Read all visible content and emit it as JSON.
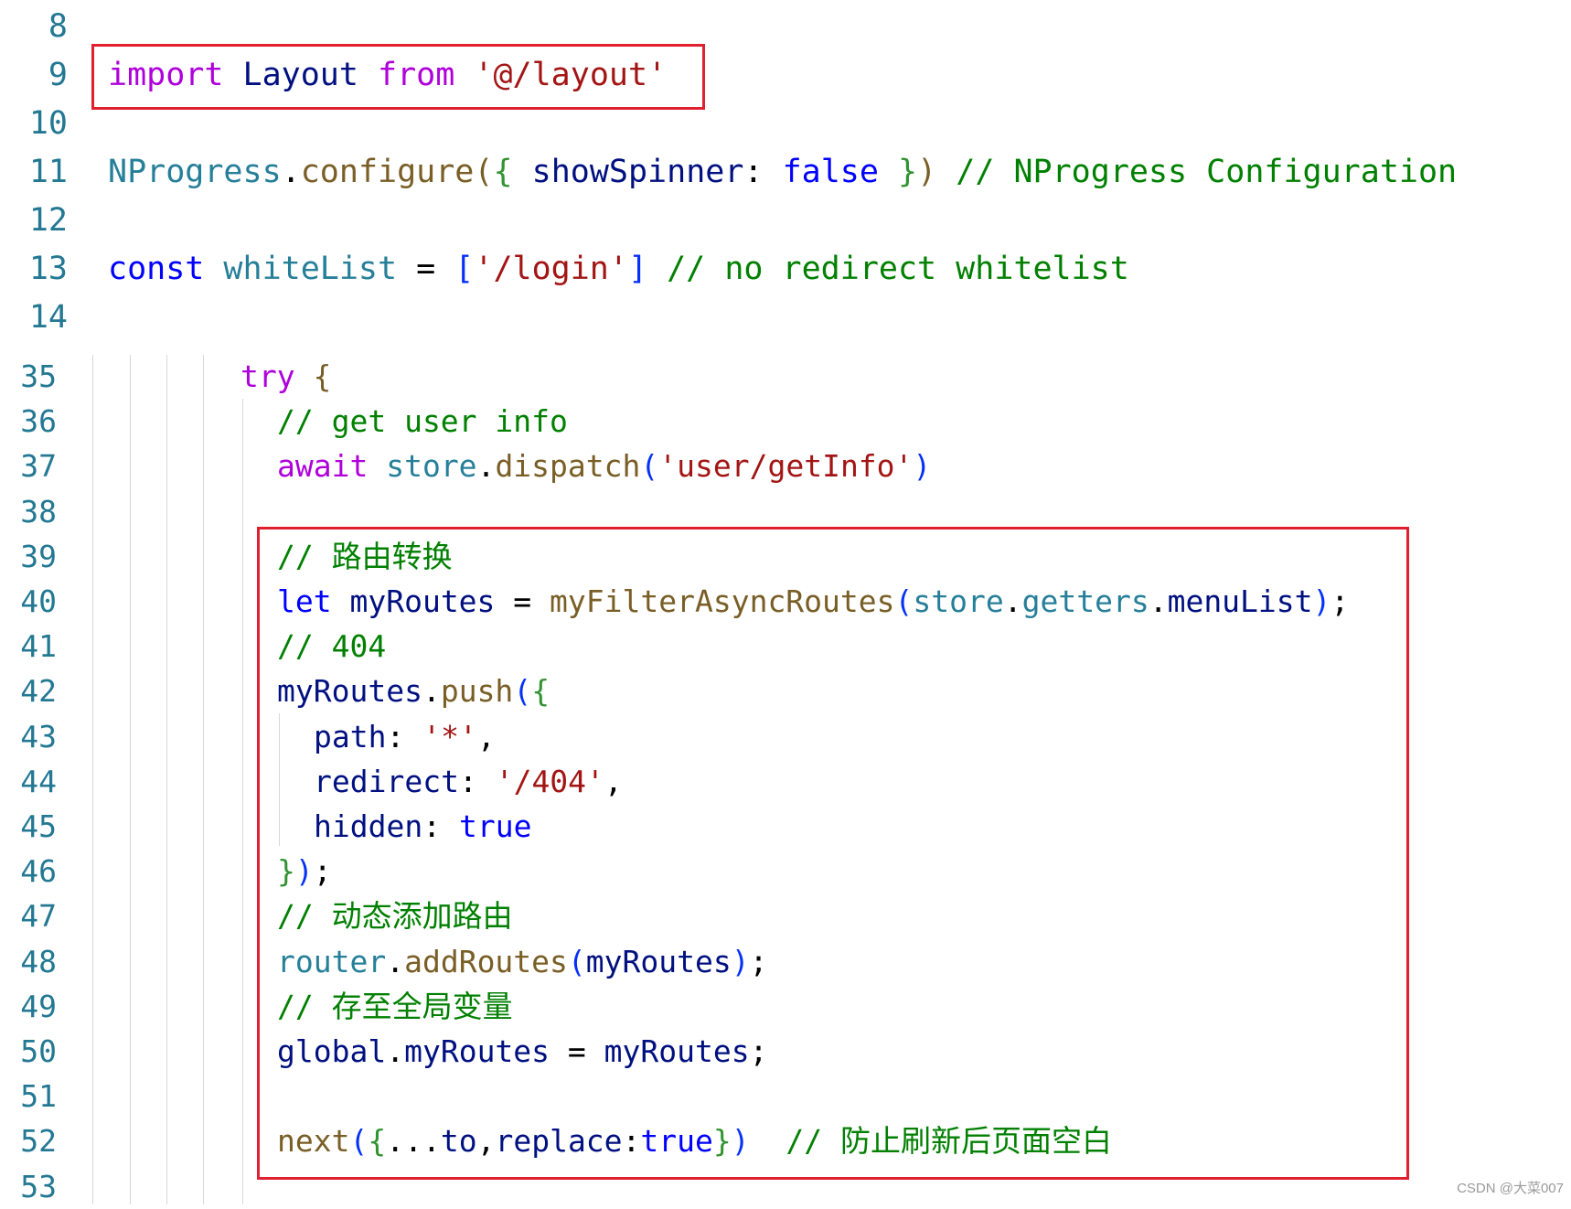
{
  "colors": {
    "keyword_control": "#af00db",
    "keyword_storage": "#0000ff",
    "identifier": "#001080",
    "function": "#795e26",
    "string": "#a31515",
    "comment": "#008000",
    "line_number": "#237893",
    "highlight_box": "#e0202e"
  },
  "top_block": [
    {
      "ln": "8",
      "tokens": []
    },
    {
      "ln": "9",
      "tokens": [
        {
          "t": "import",
          "c": "kw-purple"
        },
        {
          "t": " Layout ",
          "c": "ident"
        },
        {
          "t": "from",
          "c": "kw-purple"
        },
        {
          "t": " ",
          "c": "punc"
        },
        {
          "t": "'@/layout'",
          "c": "str"
        }
      ]
    },
    {
      "ln": "10",
      "tokens": []
    },
    {
      "ln": "11",
      "tokens": [
        {
          "t": "NProgress",
          "c": "typename"
        },
        {
          "t": ".",
          "c": "punc"
        },
        {
          "t": "configure",
          "c": "func"
        },
        {
          "t": "(",
          "c": "brace-y"
        },
        {
          "t": "{",
          "c": "brace-p"
        },
        {
          "t": " showSpinner",
          "c": "ident"
        },
        {
          "t": ": ",
          "c": "punc"
        },
        {
          "t": "false",
          "c": "bool"
        },
        {
          "t": " ",
          "c": "punc"
        },
        {
          "t": "}",
          "c": "brace-p"
        },
        {
          "t": ")",
          "c": "brace-y"
        },
        {
          "t": " // NProgress Configuration",
          "c": "cmt"
        }
      ]
    },
    {
      "ln": "12",
      "tokens": []
    },
    {
      "ln": "13",
      "tokens": [
        {
          "t": "const",
          "c": "kw-blue"
        },
        {
          "t": " whiteList",
          "c": "typename"
        },
        {
          "t": " = ",
          "c": "punc"
        },
        {
          "t": "[",
          "c": "brace-b"
        },
        {
          "t": "'/login'",
          "c": "str"
        },
        {
          "t": "]",
          "c": "brace-b"
        },
        {
          "t": " // no redirect whitelist",
          "c": "cmt"
        }
      ]
    },
    {
      "ln": "14",
      "tokens": []
    }
  ],
  "bottom_block": [
    {
      "ln": "35",
      "indent": 0,
      "tokens": [
        {
          "t": "try",
          "c": "kw-purple"
        },
        {
          "t": " ",
          "c": "punc"
        },
        {
          "t": "{",
          "c": "brace-y"
        }
      ]
    },
    {
      "ln": "36",
      "indent": 1,
      "tokens": [
        {
          "t": "// get user info",
          "c": "cmt"
        }
      ]
    },
    {
      "ln": "37",
      "indent": 1,
      "tokens": [
        {
          "t": "await",
          "c": "kw-purple"
        },
        {
          "t": " store",
          "c": "typename"
        },
        {
          "t": ".",
          "c": "punc"
        },
        {
          "t": "dispatch",
          "c": "func"
        },
        {
          "t": "(",
          "c": "brace-b"
        },
        {
          "t": "'user/getInfo'",
          "c": "str"
        },
        {
          "t": ")",
          "c": "brace-b"
        }
      ]
    },
    {
      "ln": "38",
      "indent": 1,
      "tokens": []
    },
    {
      "ln": "39",
      "indent": 1,
      "tokens": [
        {
          "t": "// 路由转换",
          "c": "cmt"
        }
      ]
    },
    {
      "ln": "40",
      "indent": 1,
      "tokens": [
        {
          "t": "let",
          "c": "kw-blue"
        },
        {
          "t": " myRoutes",
          "c": "ident"
        },
        {
          "t": " = ",
          "c": "punc"
        },
        {
          "t": "myFilterAsyncRoutes",
          "c": "func"
        },
        {
          "t": "(",
          "c": "brace-b"
        },
        {
          "t": "store",
          "c": "typename"
        },
        {
          "t": ".",
          "c": "punc"
        },
        {
          "t": "getters",
          "c": "typename"
        },
        {
          "t": ".",
          "c": "punc"
        },
        {
          "t": "menuList",
          "c": "ident"
        },
        {
          "t": ")",
          "c": "brace-b"
        },
        {
          "t": ";",
          "c": "punc"
        }
      ]
    },
    {
      "ln": "41",
      "indent": 1,
      "tokens": [
        {
          "t": "// 404",
          "c": "cmt"
        }
      ]
    },
    {
      "ln": "42",
      "indent": 1,
      "tokens": [
        {
          "t": "myRoutes",
          "c": "ident"
        },
        {
          "t": ".",
          "c": "punc"
        },
        {
          "t": "push",
          "c": "func"
        },
        {
          "t": "(",
          "c": "brace-b"
        },
        {
          "t": "{",
          "c": "brace-p"
        }
      ]
    },
    {
      "ln": "43",
      "indent": 2,
      "tokens": [
        {
          "t": "path",
          "c": "ident"
        },
        {
          "t": ": ",
          "c": "punc"
        },
        {
          "t": "'*'",
          "c": "str"
        },
        {
          "t": ",",
          "c": "punc"
        }
      ]
    },
    {
      "ln": "44",
      "indent": 2,
      "tokens": [
        {
          "t": "redirect",
          "c": "ident"
        },
        {
          "t": ": ",
          "c": "punc"
        },
        {
          "t": "'/404'",
          "c": "str"
        },
        {
          "t": ",",
          "c": "punc"
        }
      ]
    },
    {
      "ln": "45",
      "indent": 2,
      "tokens": [
        {
          "t": "hidden",
          "c": "ident"
        },
        {
          "t": ": ",
          "c": "punc"
        },
        {
          "t": "true",
          "c": "bool"
        }
      ]
    },
    {
      "ln": "46",
      "indent": 1,
      "tokens": [
        {
          "t": "}",
          "c": "brace-p"
        },
        {
          "t": ")",
          "c": "brace-b"
        },
        {
          "t": ";",
          "c": "punc"
        }
      ]
    },
    {
      "ln": "47",
      "indent": 1,
      "tokens": [
        {
          "t": "// 动态添加路由",
          "c": "cmt"
        }
      ]
    },
    {
      "ln": "48",
      "indent": 1,
      "tokens": [
        {
          "t": "router",
          "c": "typename"
        },
        {
          "t": ".",
          "c": "punc"
        },
        {
          "t": "addRoutes",
          "c": "func"
        },
        {
          "t": "(",
          "c": "brace-b"
        },
        {
          "t": "myRoutes",
          "c": "ident"
        },
        {
          "t": ")",
          "c": "brace-b"
        },
        {
          "t": ";",
          "c": "punc"
        }
      ]
    },
    {
      "ln": "49",
      "indent": 1,
      "tokens": [
        {
          "t": "// 存至全局变量",
          "c": "cmt"
        }
      ]
    },
    {
      "ln": "50",
      "indent": 1,
      "tokens": [
        {
          "t": "global",
          "c": "ident"
        },
        {
          "t": ".",
          "c": "punc"
        },
        {
          "t": "myRoutes",
          "c": "ident"
        },
        {
          "t": " = ",
          "c": "punc"
        },
        {
          "t": "myRoutes",
          "c": "ident"
        },
        {
          "t": ";",
          "c": "punc"
        }
      ]
    },
    {
      "ln": "51",
      "indent": 1,
      "tokens": []
    },
    {
      "ln": "52",
      "indent": 1,
      "tokens": [
        {
          "t": "next",
          "c": "func"
        },
        {
          "t": "(",
          "c": "brace-b"
        },
        {
          "t": "{",
          "c": "brace-p"
        },
        {
          "t": "...",
          "c": "punc"
        },
        {
          "t": "to",
          "c": "ident"
        },
        {
          "t": ",",
          "c": "punc"
        },
        {
          "t": "replace",
          "c": "ident"
        },
        {
          "t": ":",
          "c": "punc"
        },
        {
          "t": "true",
          "c": "bool"
        },
        {
          "t": "}",
          "c": "brace-p"
        },
        {
          "t": ")",
          "c": "brace-b"
        },
        {
          "t": "  // 防止刷新后页面空白",
          "c": "cmt"
        }
      ]
    },
    {
      "ln": "53",
      "indent": 1,
      "tokens": []
    }
  ],
  "watermark": "CSDN @大菜007"
}
